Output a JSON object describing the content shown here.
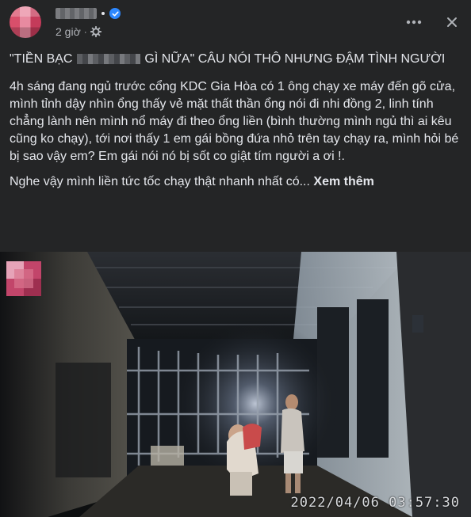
{
  "post": {
    "author": {
      "avatar": "blurred-avatar",
      "name_hidden": true,
      "verified": true
    },
    "time": "2 giờ",
    "meta_separator": "·",
    "privacy_icon": "gear-icon",
    "title_before": "\"TIỀN BẠC",
    "title_after": "GÌ NỮA\" CÂU NÓI THÔ NHƯNG ĐẬM TÌNH NGƯỜI",
    "body": "4h sáng đang ngủ trước cổng KDC Gia Hòa có 1 ông chạy xe máy đến gõ cửa, mình tỉnh dậy nhìn ổng thấy vẻ mặt thất thần ổng nói đi nhi đồng 2, linh tính chẳng lành nên mình nổ máy đi theo ổng liền (bình thường mình ngủ thì ai kêu cũng ko chạy), tới nơi thấy 1 em gái bồng đứa nhỏ trên tay chạy ra, mình hỏi bé bị sao vậy em? Em gái nói nó bị sốt co giật tím người a ơi !.",
    "preview": "Nghe vậy mình liền tức tốc chạy thật nhanh nhất có...",
    "see_more": "Xem thêm",
    "video": {
      "timestamp": "2022/04/06 03:57:30",
      "watermark": "blurred-logo"
    }
  },
  "actions": {
    "more_icon": "more-horizontal-icon",
    "close_icon": "close-icon"
  },
  "colors": {
    "background": "#242526",
    "text": "#e4e6eb",
    "secondary_text": "#b0b3b8",
    "verified": "#2d88ff"
  }
}
